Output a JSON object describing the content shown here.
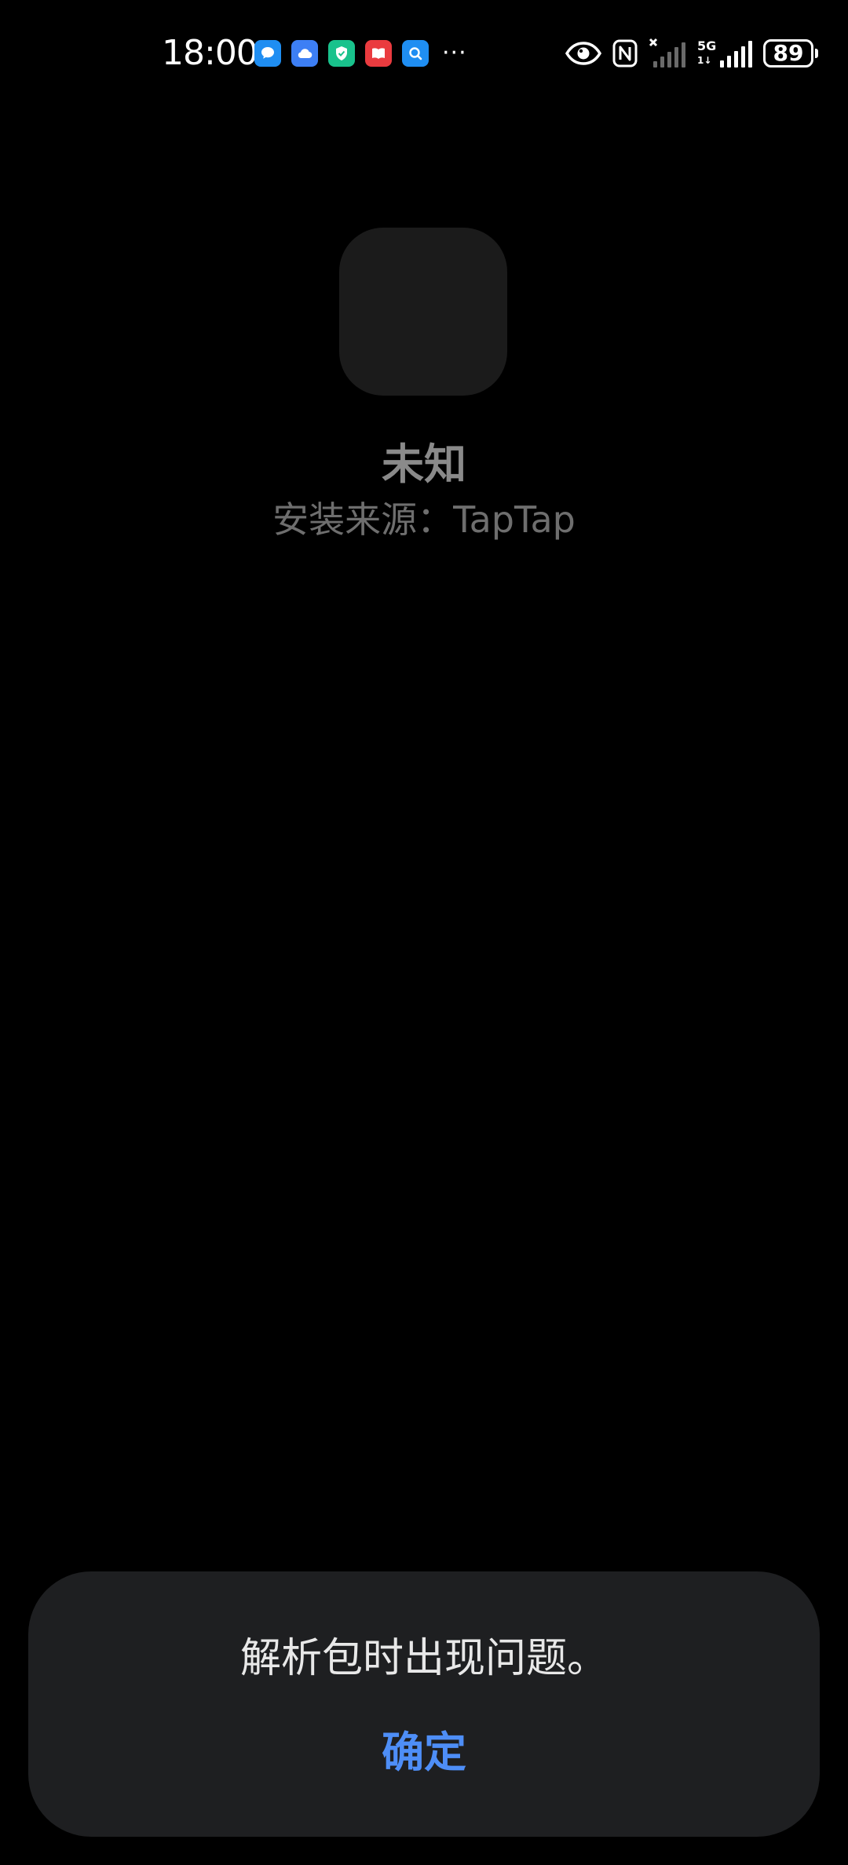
{
  "status_bar": {
    "time": "18:00",
    "notification_icons": [
      {
        "name": "message-app-icon",
        "color": "#1f8ef2"
      },
      {
        "name": "cloud-app-icon",
        "color": "#3d7ff5"
      },
      {
        "name": "shield-app-icon",
        "color": "#19c28c"
      },
      {
        "name": "book-app-icon",
        "color": "#ea3b3f"
      },
      {
        "name": "search-app-icon",
        "color": "#1f8ef2"
      }
    ],
    "more_indicator": "···",
    "network_type": "5G",
    "network_sub": "1↓",
    "battery_level": "89"
  },
  "app": {
    "name": "未知",
    "install_source": "安装来源：TapTap"
  },
  "dialog": {
    "message": "解析包时出现问题。",
    "confirm_label": "确定"
  },
  "colors": {
    "background": "#000000",
    "dialog_background": "#1e1f21",
    "accent": "#4e8ef7"
  }
}
